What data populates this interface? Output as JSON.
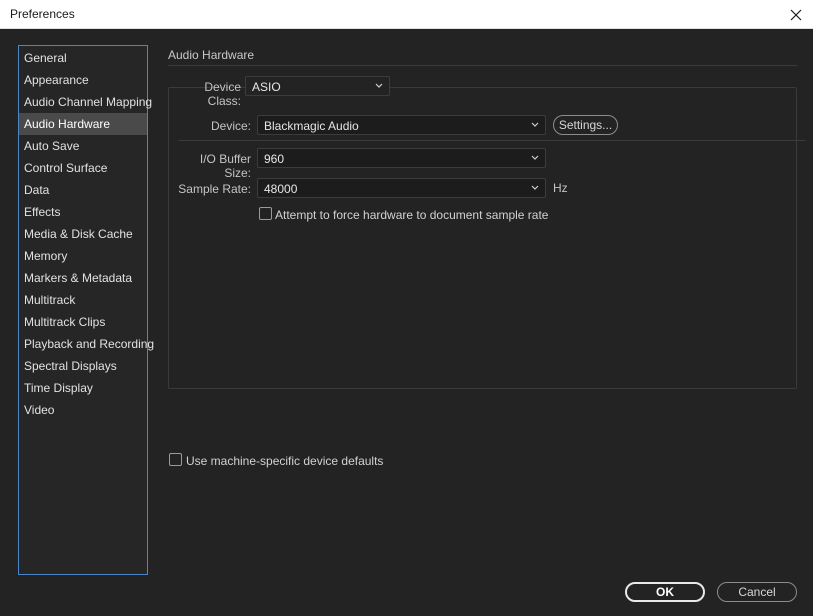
{
  "window": {
    "title": "Preferences"
  },
  "sidebar": {
    "items": [
      {
        "label": "General"
      },
      {
        "label": "Appearance"
      },
      {
        "label": "Audio Channel Mapping"
      },
      {
        "label": "Audio Hardware",
        "selected": true
      },
      {
        "label": "Auto Save"
      },
      {
        "label": "Control Surface"
      },
      {
        "label": "Data"
      },
      {
        "label": "Effects"
      },
      {
        "label": "Media & Disk Cache"
      },
      {
        "label": "Memory"
      },
      {
        "label": "Markers & Metadata"
      },
      {
        "label": "Multitrack"
      },
      {
        "label": "Multitrack Clips"
      },
      {
        "label": "Playback and Recording"
      },
      {
        "label": "Spectral Displays"
      },
      {
        "label": "Time Display"
      },
      {
        "label": "Video"
      }
    ]
  },
  "panel": {
    "title": "Audio Hardware",
    "device_class": {
      "label": "Device Class:",
      "value": "ASIO"
    },
    "device": {
      "label": "Device:",
      "value": "Blackmagic Audio"
    },
    "settings_button": "Settings...",
    "buffer": {
      "label": "I/O Buffer Size:",
      "value": "960"
    },
    "sample_rate": {
      "label": "Sample Rate:",
      "value": "48000",
      "unit": "Hz"
    },
    "force_rate": {
      "label": "Attempt to force hardware to document sample rate",
      "checked": false
    },
    "machine_defaults": {
      "label": "Use machine-specific device defaults",
      "checked": false
    }
  },
  "buttons": {
    "ok": "OK",
    "cancel": "Cancel"
  },
  "icons": {
    "close": "close-icon",
    "dropdown": "chevron-down-icon"
  },
  "colors": {
    "selection_bg": "#4a4a4a",
    "sidebar_border": "#4b86c9",
    "background": "#232323"
  }
}
